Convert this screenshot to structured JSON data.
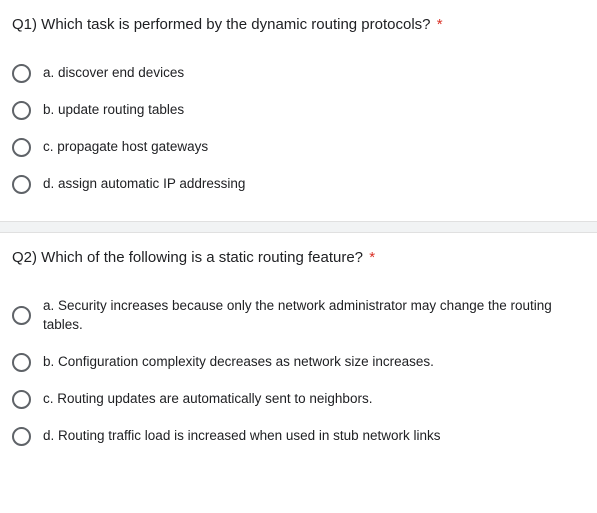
{
  "questions": [
    {
      "title": "Q1) Which task is performed by the dynamic routing protocols?",
      "required": "*",
      "options": [
        "a. discover end devices",
        "b. update routing tables",
        "c. propagate host gateways",
        "d. assign automatic IP addressing"
      ]
    },
    {
      "title": "Q2) Which of the following is a static routing feature?",
      "required": "*",
      "options": [
        "a. Security increases because only the network administrator may change the routing tables.",
        "b. Configuration complexity decreases as network size increases.",
        "c. Routing updates are automatically sent to neighbors.",
        "d. Routing traffic load is increased when used in stub network links"
      ]
    }
  ]
}
